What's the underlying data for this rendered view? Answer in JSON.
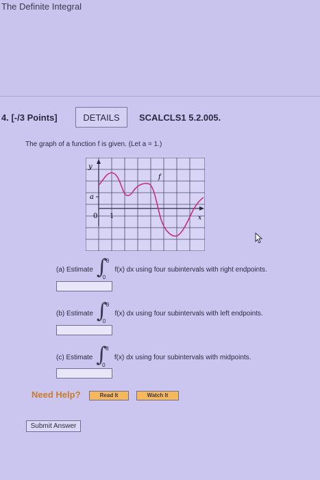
{
  "page_title": "The Definite Integral",
  "question": {
    "number": "4.",
    "points": "[-/3 Points]",
    "details_label": "DETAILS",
    "code": "SCALCLS1 5.2.005.",
    "prompt": "The graph of a function f is given. (Let a = 1.)"
  },
  "graph": {
    "y_label": "y",
    "x_label": "x",
    "a_label": "a",
    "f_label": "f",
    "origin_label": "0",
    "one_label": "1",
    "curve_color": "#c0307a"
  },
  "parts": [
    {
      "label": "(a) Estimate",
      "upper": "8",
      "lower": "0",
      "text": "f(x) dx using four subintervals with right endpoints.",
      "value": ""
    },
    {
      "label": "(b) Estimate",
      "upper": "8",
      "lower": "0",
      "text": "f(x) dx using four subintervals with left endpoints.",
      "value": ""
    },
    {
      "label": "(c) Estimate",
      "upper": "8",
      "lower": "0",
      "text": "f(x) dx using four subintervals with midpoints.",
      "value": ""
    }
  ],
  "help": {
    "label": "Need Help?",
    "read_label": "Read It",
    "watch_label": "Watch It"
  },
  "submit_label": "Submit Answer"
}
